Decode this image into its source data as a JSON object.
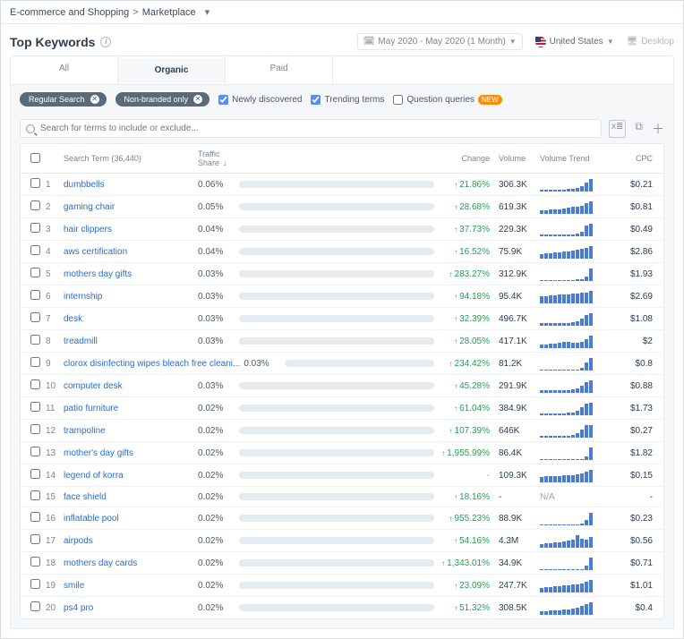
{
  "breadcrumb": {
    "group": "E-commerce and Shopping",
    "sep": ">",
    "page": "Marketplace"
  },
  "title": "Top Keywords",
  "header": {
    "date_range": "May 2020 - May 2020 (1 Month)",
    "country": "United States",
    "device": "Desktop"
  },
  "tabs": {
    "all": "All",
    "organic": "Organic",
    "paid": "Paid"
  },
  "filters": {
    "pill1": "Regular Search",
    "pill2": "Non-branded only",
    "newly": "Newly discovered",
    "trending": "Trending terms",
    "questions": "Question queries",
    "new_badge": "NEW"
  },
  "search_placeholder": "Search for terms to include or exclude...",
  "columns": {
    "term": "Search Term (36,440)",
    "share": "Traffic Share",
    "change": "Change",
    "volume": "Volume",
    "trend": "Volume Trend",
    "cpc": "CPC"
  },
  "rows": [
    {
      "n": "1",
      "term": "dumbbells",
      "share": "0.06%",
      "change": "21.86%",
      "vol": "306.3K",
      "cpc": "$0.21",
      "spark": [
        2,
        2,
        2,
        2,
        2,
        2,
        3,
        3,
        4,
        6,
        10,
        14
      ]
    },
    {
      "n": "2",
      "term": "gaming chair",
      "share": "0.05%",
      "change": "28.68%",
      "vol": "619.3K",
      "cpc": "$0.81",
      "spark": [
        4,
        4,
        5,
        5,
        5,
        6,
        7,
        8,
        8,
        9,
        12,
        14
      ]
    },
    {
      "n": "3",
      "term": "hair clippers",
      "share": "0.04%",
      "change": "37.73%",
      "vol": "229.3K",
      "cpc": "$0.49",
      "spark": [
        2,
        2,
        2,
        2,
        2,
        2,
        2,
        2,
        3,
        5,
        12,
        14
      ]
    },
    {
      "n": "4",
      "term": "aws certification",
      "share": "0.04%",
      "change": "16.52%",
      "vol": "75.9K",
      "cpc": "$2.86",
      "spark": [
        5,
        6,
        6,
        7,
        7,
        8,
        8,
        9,
        10,
        11,
        12,
        14
      ]
    },
    {
      "n": "5",
      "term": "mothers day gifts",
      "share": "0.03%",
      "change": "283.27%",
      "vol": "312.9K",
      "cpc": "$1.93",
      "spark": [
        1,
        1,
        1,
        1,
        1,
        1,
        1,
        1,
        2,
        2,
        5,
        14
      ]
    },
    {
      "n": "6",
      "term": "internship",
      "share": "0.03%",
      "change": "94.18%",
      "vol": "95.4K",
      "cpc": "$2.69",
      "spark": [
        8,
        8,
        9,
        9,
        10,
        10,
        10,
        11,
        11,
        12,
        12,
        14
      ]
    },
    {
      "n": "7",
      "term": "desk",
      "share": "0.03%",
      "change": "32.39%",
      "vol": "496.7K",
      "cpc": "$1.08",
      "spark": [
        3,
        3,
        3,
        3,
        3,
        3,
        3,
        4,
        5,
        8,
        12,
        14
      ]
    },
    {
      "n": "8",
      "term": "treadmill",
      "share": "0.03%",
      "change": "28.05%",
      "vol": "417.1K",
      "cpc": "$2",
      "spark": [
        4,
        4,
        5,
        5,
        6,
        7,
        7,
        6,
        6,
        7,
        10,
        14
      ]
    },
    {
      "n": "9",
      "term": "clorox disinfecting wipes bleach free cleani...",
      "share": "0.03%",
      "change": "234.42%",
      "vol": "81.2K",
      "cpc": "$0.8",
      "spark": [
        0,
        0,
        0,
        0,
        0,
        0,
        0,
        0,
        1,
        3,
        9,
        14
      ]
    },
    {
      "n": "10",
      "term": "computer desk",
      "share": "0.03%",
      "change": "45.28%",
      "vol": "291.9K",
      "cpc": "$0.88",
      "spark": [
        3,
        3,
        3,
        3,
        3,
        3,
        3,
        4,
        5,
        8,
        12,
        14
      ]
    },
    {
      "n": "11",
      "term": "patio furniture",
      "share": "0.02%",
      "change": "61.04%",
      "vol": "384.9K",
      "cpc": "$1.73",
      "spark": [
        2,
        2,
        2,
        2,
        2,
        2,
        3,
        3,
        5,
        9,
        13,
        14
      ]
    },
    {
      "n": "12",
      "term": "trampoline",
      "share": "0.02%",
      "change": "107.39%",
      "vol": "646K",
      "cpc": "$0.27",
      "spark": [
        2,
        2,
        2,
        2,
        2,
        2,
        2,
        3,
        5,
        9,
        14,
        14
      ]
    },
    {
      "n": "13",
      "term": "mother's day gifts",
      "share": "0.02%",
      "change": "1,955.99%",
      "vol": "86.4K",
      "cpc": "$1.82",
      "spark": [
        0,
        0,
        0,
        0,
        0,
        0,
        0,
        0,
        1,
        1,
        4,
        14
      ]
    },
    {
      "n": "14",
      "term": "legend of korra",
      "share": "0.02%",
      "change": "-",
      "vol": "109.3K",
      "cpc": "$0.15",
      "spark": [
        6,
        7,
        7,
        7,
        7,
        8,
        8,
        8,
        9,
        10,
        12,
        14
      ]
    },
    {
      "n": "15",
      "term": "face shield",
      "share": "0.02%",
      "change": "18.16%",
      "vol": "-",
      "cpc": "-",
      "trend_na": "N/A"
    },
    {
      "n": "16",
      "term": "inflatable pool",
      "share": "0.02%",
      "change": "955.23%",
      "vol": "88.9K",
      "cpc": "$0.23",
      "spark": [
        1,
        1,
        1,
        1,
        1,
        1,
        1,
        1,
        1,
        2,
        6,
        14
      ]
    },
    {
      "n": "17",
      "term": "airpods",
      "share": "0.02%",
      "change": "54.16%",
      "vol": "4.3M",
      "cpc": "$0.56",
      "spark": [
        4,
        5,
        5,
        6,
        6,
        7,
        8,
        9,
        14,
        10,
        9,
        12
      ]
    },
    {
      "n": "18",
      "term": "mothers day cards",
      "share": "0.02%",
      "change": "1,343.01%",
      "vol": "34.9K",
      "cpc": "$0.71",
      "spark": [
        0,
        0,
        0,
        0,
        0,
        0,
        0,
        0,
        1,
        1,
        5,
        14
      ]
    },
    {
      "n": "19",
      "term": "smile",
      "share": "0.02%",
      "change": "23.09%",
      "vol": "247.7K",
      "cpc": "$1.01",
      "spark": [
        5,
        6,
        6,
        7,
        7,
        8,
        8,
        9,
        9,
        10,
        12,
        14
      ]
    },
    {
      "n": "20",
      "term": "ps4 pro",
      "share": "0.02%",
      "change": "51.32%",
      "vol": "308.5K",
      "cpc": "$0.4",
      "spark": [
        4,
        4,
        5,
        5,
        5,
        6,
        6,
        7,
        8,
        10,
        12,
        14
      ]
    }
  ]
}
